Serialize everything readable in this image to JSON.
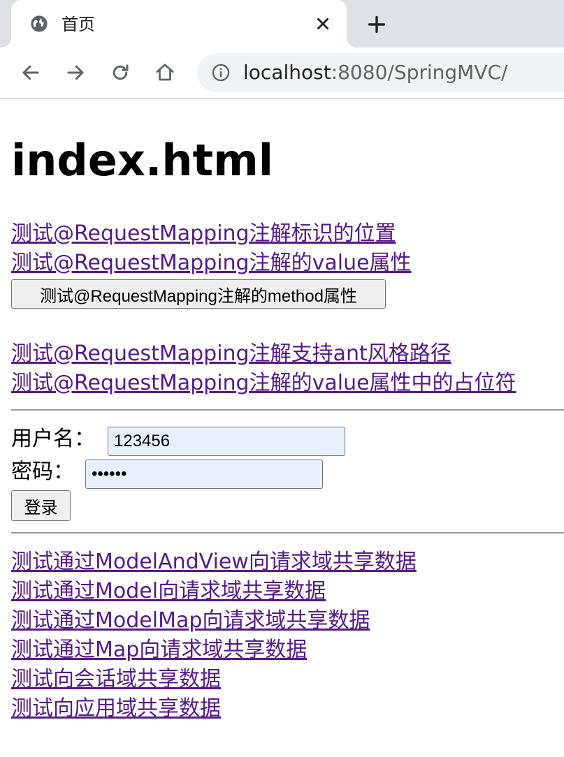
{
  "browser": {
    "tab_title": "首页",
    "url_host": "localhost",
    "url_rest": ":8080/SpringMVC/",
    "icons": [
      "globe-icon",
      "close-icon",
      "plus-icon",
      "back-icon",
      "forward-icon",
      "reload-icon",
      "home-icon",
      "info-icon"
    ]
  },
  "page": {
    "heading": "index.html",
    "links_group1": [
      "测试@RequestMapping注解标识的位置",
      "测试@RequestMapping注解的value属性"
    ],
    "method_button": "测试@RequestMapping注解的method属性",
    "links_group2": [
      "测试@RequestMapping注解支持ant风格路径",
      "测试@RequestMapping注解的value属性中的占位符"
    ],
    "form": {
      "username_label": "用户名：",
      "username_value": "123456",
      "password_label": "密码：",
      "password_value": "••••••",
      "submit_label": "登录"
    },
    "links_group3": [
      "测试通过ModelAndView向请求域共享数据",
      "测试通过Model向请求域共享数据",
      "测试通过ModelMap向请求域共享数据",
      "测试通过Map向请求域共享数据",
      "测试向会话域共享数据",
      "测试向应用域共享数据"
    ]
  }
}
